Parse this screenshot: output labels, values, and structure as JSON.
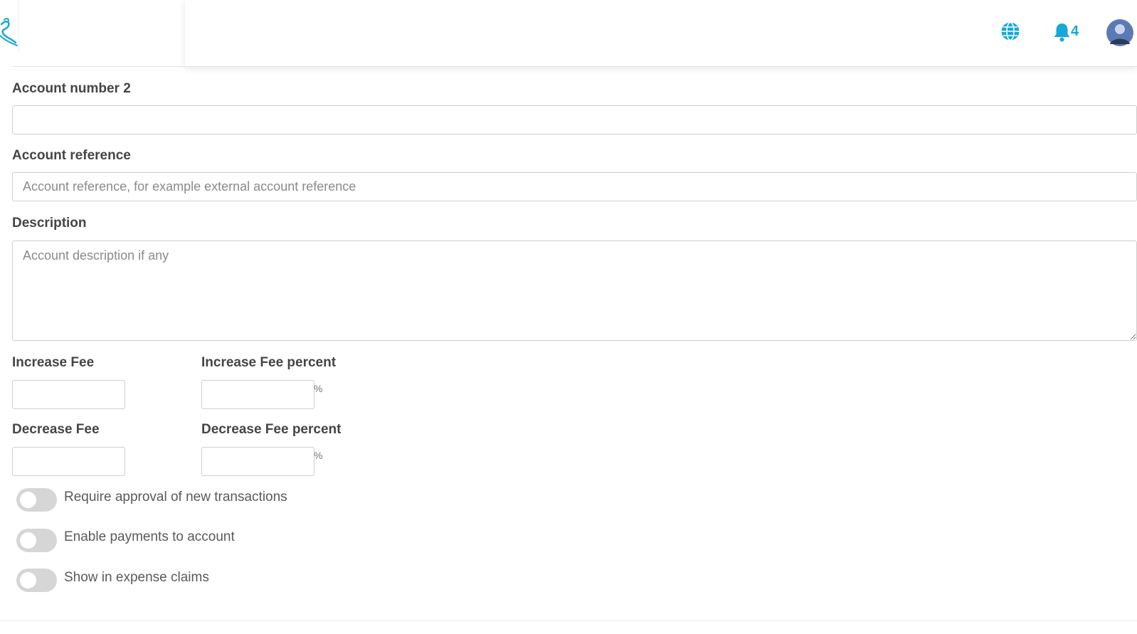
{
  "header": {
    "notifications_count": "4",
    "accent_color": "#17a8d6"
  },
  "form": {
    "account_number_2": {
      "label": "Account number 2",
      "value": "",
      "placeholder": ""
    },
    "account_reference": {
      "label": "Account reference",
      "value": "",
      "placeholder": "Account reference, for example external account reference"
    },
    "description": {
      "label": "Description",
      "value": "",
      "placeholder": "Account description if any"
    },
    "increase_fee": {
      "label": "Increase Fee",
      "value": ""
    },
    "increase_fee_percent": {
      "label": "Increase Fee percent",
      "value": "",
      "unit": "%"
    },
    "decrease_fee": {
      "label": "Decrease Fee",
      "value": ""
    },
    "decrease_fee_percent": {
      "label": "Decrease Fee percent",
      "value": "",
      "unit": "%"
    },
    "toggles": [
      {
        "label": "Require approval of new transactions",
        "on": false
      },
      {
        "label": "Enable payments to account",
        "on": false
      },
      {
        "label": "Show in expense claims",
        "on": false
      }
    ]
  }
}
